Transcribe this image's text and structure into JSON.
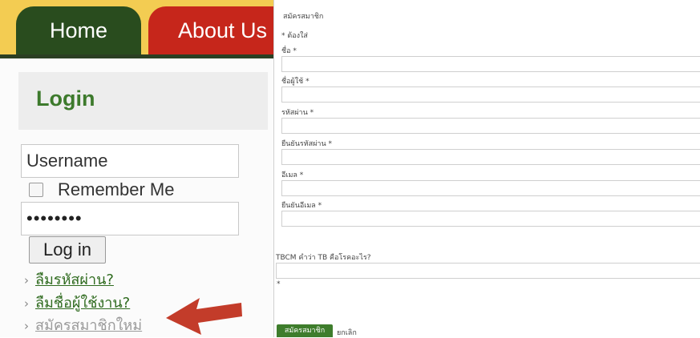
{
  "nav": {
    "home": "Home",
    "about": "About Us"
  },
  "login": {
    "title": "Login",
    "username_value": "Username",
    "remember_label": "Remember Me",
    "password_value": "••••••••",
    "submit_label": "Log in",
    "links": {
      "forgot_password": "ลืมรหัสผ่าน?",
      "forgot_username": "ลืมชื่อผู้ใช้งาน?",
      "register": "สมัครสมาชิกใหม่"
    }
  },
  "register": {
    "title": "สมัครสมาชิก",
    "required_note": "* ต้องใส่",
    "fields": {
      "name": "ชื่อ *",
      "username": "ชื่อผู้ใช้ *",
      "password": "รหัสผ่าน *",
      "confirm_password": "ยืนยันรหัสผ่าน *",
      "email": "อีเมล *",
      "confirm_email": "ยืนยันอีเมล *"
    },
    "question_label": "TBCM คำว่า TB คือโรคอะไร?",
    "question_required_mark": "*",
    "submit_label": "สมัครสมาชิก",
    "cancel_label": "ยกเลิก"
  },
  "colors": {
    "nav_bar": "#f3cc52",
    "home_tab": "#294c1e",
    "about_tab": "#c6261b",
    "login_title": "#3d7a2c",
    "link_green": "#2f6b1f",
    "arrow_red": "#c33c2a",
    "submit_green": "#3e7d2c"
  },
  "icons": {
    "link_bullet": "chevron-right-icon",
    "annotation": "red-arrow-icon"
  }
}
